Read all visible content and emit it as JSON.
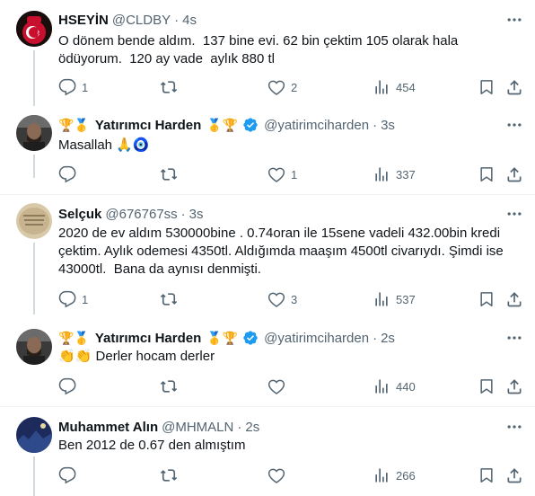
{
  "tweets": [
    {
      "name": "HSEYİN",
      "handle": "@CLDBY",
      "time": "4s",
      "text": "O dönem bende aldım.  137 bine evi. 62 bin çektim 105 olarak hala ödüyorum.  120 ay vade  aylık 880 tl",
      "replies": "1",
      "retweets": "",
      "likes": "2",
      "views": "454"
    },
    {
      "name": "Yatırımcı Harden",
      "badges_before": "🏆🥇",
      "badges_after": "🥇🏆",
      "handle": "@yatirimciharden",
      "time": "3s",
      "text": "Masallah 🙏🧿",
      "replies": "",
      "retweets": "",
      "likes": "1",
      "views": "337"
    },
    {
      "name": "Selçuk",
      "handle": "@676767ss",
      "time": "3s",
      "text": "2020 de ev aldım 530000bine . 0.74oran ile 15sene vadeli 432.00bin kredi çektim. Aylık odemesi 4350tl. Aldığımda maaşım 4500tl civarıydı. Şimdi ise 43000tl.  Bana da aynısı denmişti.",
      "replies": "1",
      "retweets": "",
      "likes": "3",
      "views": "537"
    },
    {
      "name": "Yatırımcı Harden",
      "badges_before": "🏆🥇",
      "badges_after": "🥇🏆",
      "handle": "@yatirimciharden",
      "time": "2s",
      "text": "👏👏 Derler hocam derler",
      "replies": "",
      "retweets": "",
      "likes": "",
      "views": "440"
    },
    {
      "name": "Muhammet Alın",
      "handle": "@MHMALN",
      "time": "2s",
      "text": "Ben 2012 de 0.67 den almıştım",
      "replies": "",
      "retweets": "",
      "likes": "",
      "views": "266"
    }
  ],
  "icons": {
    "reply": "reply-icon",
    "retweet": "retweet-icon",
    "like": "like-icon",
    "views": "views-icon",
    "bookmark": "bookmark-icon",
    "share": "share-icon",
    "more": "more-icon",
    "verified": "verified-badge-icon"
  },
  "colors": {
    "text": "#0f1419",
    "secondary": "#536471",
    "verified": "#1d9bf0",
    "divider": "#eff3f4"
  }
}
